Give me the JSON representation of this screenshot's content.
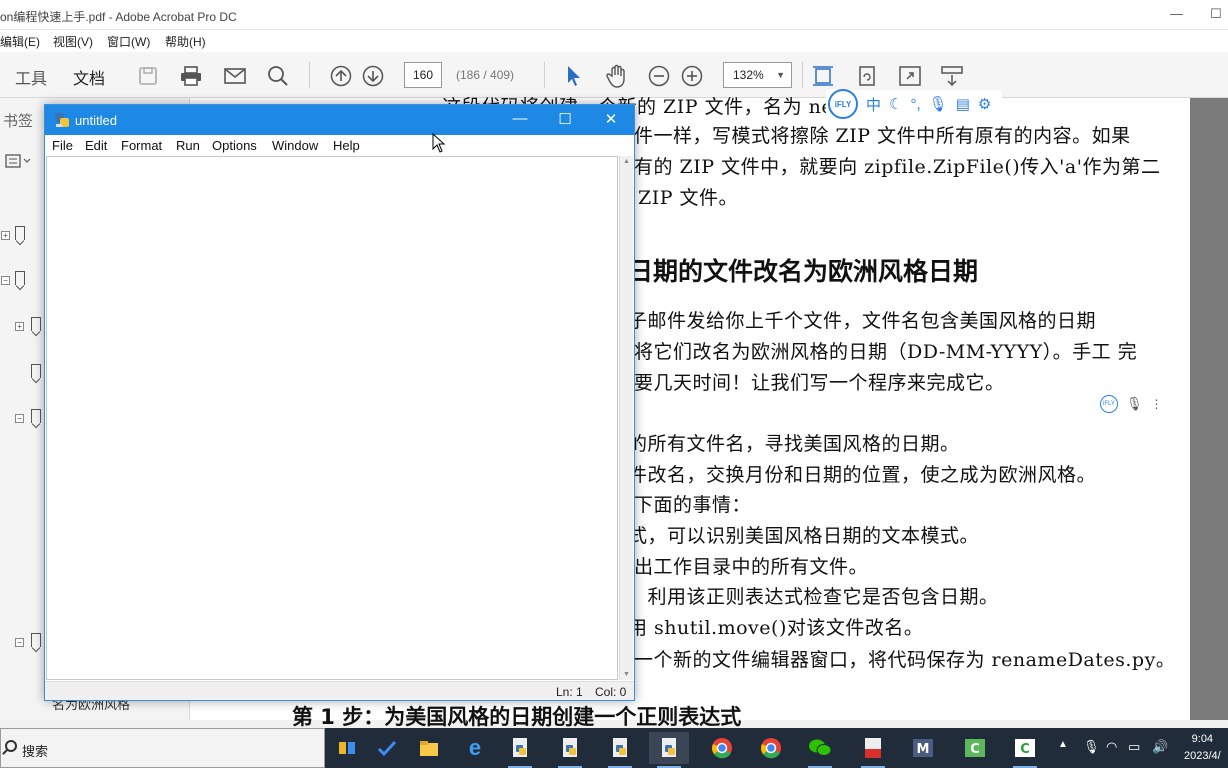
{
  "acrobat": {
    "title": "on编程快速上手.pdf - Adobe Acrobat Pro DC",
    "menu": [
      "编辑(E)",
      "视图(V)",
      "窗口(W)",
      "帮助(H)"
    ],
    "tabs": {
      "tools": "工具",
      "document": "文档"
    },
    "page_number": "160",
    "page_count": "(186 / 409)",
    "zoom": "132%",
    "nav_label": "书签",
    "nav_bottom_text": "名为欧洲风格"
  },
  "document": {
    "lines": [
      "这段代码将创建一个新的 ZIP 文件，名为 ne         txt 压缩后的内容。",
      "件一样，写模式将擦除 ZIP 文件中所有原有的内容。如果",
      "有的 ZIP 文件中，就要向 zipfile.ZipFile()传入'a'作为第二",
      "ZIP 文件。"
    ],
    "heading": "日期的文件改名为欧洲风格日期",
    "para": [
      "子邮件发给你上千个文件，文件名包含美国风格的日期",
      "将它们改名为欧洲风格的日期（DD-MM-YYYY）。手工 完",
      "要几天时间！让我们写一个程序来完成它。",
      "：",
      "的所有文件名，寻找美国风格的日期。",
      "件改名，交换月份和日期的位置，使之成为欧洲风格。",
      "下面的事情：",
      "式，可以识别美国风格日期的文本模式。",
      "出工作目录中的所有文件。",
      "，利用该正则表达式检查它是否包含日期。",
      "用 shutil.move()对该文件改名。",
      "一个新的文件编辑器窗口，将代码保存为 renameDates.py。"
    ],
    "step_heading": "第 1 步：为美国风格的日期创建一个正则表达式",
    "ifly_logo": "iFLY",
    "ifly_cn": "中"
  },
  "editor": {
    "title": "untitled",
    "menu": [
      "File",
      "Edit",
      "Format",
      "Run",
      "Options",
      "Window",
      "Help"
    ],
    "content": "",
    "status_ln": "Ln: 1",
    "status_col": "Col: 0"
  },
  "taskbar": {
    "search_placeholder": "搜索",
    "time": "9:04",
    "date": "2023/4/"
  }
}
